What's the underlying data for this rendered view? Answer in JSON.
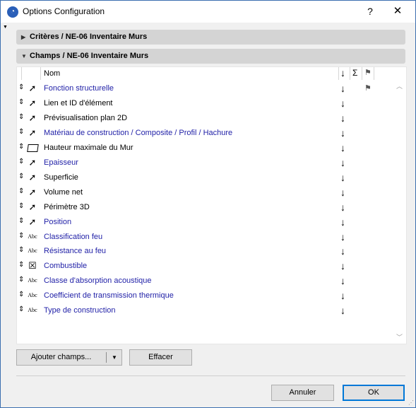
{
  "window": {
    "title": "Options Configuration",
    "help_label": "?",
    "close_label": "✕",
    "app_icon": "archicad-icon"
  },
  "sections": [
    {
      "label": "Critères / NE-06 Inventaire Murs",
      "expanded": false
    },
    {
      "label": "Champs / NE-06 Inventaire Murs",
      "expanded": true
    }
  ],
  "table": {
    "header": {
      "name": "Nom",
      "sort_symbol": "↓",
      "sum_symbol": "Σ",
      "flag_symbol": "⚑"
    },
    "rows": [
      {
        "type": "pointer",
        "name": "Fonction structurelle",
        "blue": true,
        "flag": "⚑"
      },
      {
        "type": "pointer",
        "name": "Lien et ID d'élément",
        "blue": false,
        "flag": ""
      },
      {
        "type": "pointer",
        "name": "Prévisualisation plan 2D",
        "blue": false,
        "flag": ""
      },
      {
        "type": "pointer",
        "name": "Matériau de construction / Composite / Profil / Hachure",
        "blue": true,
        "flag": ""
      },
      {
        "type": "polygon",
        "name": "Hauteur maximale du Mur",
        "blue": false,
        "flag": ""
      },
      {
        "type": "pointer",
        "name": "Epaisseur",
        "blue": true,
        "flag": ""
      },
      {
        "type": "pointer",
        "name": "Superficie",
        "blue": false,
        "flag": ""
      },
      {
        "type": "pointer",
        "name": "Volume net",
        "blue": false,
        "flag": ""
      },
      {
        "type": "pointer",
        "name": "Périmètre 3D",
        "blue": false,
        "flag": ""
      },
      {
        "type": "pointer",
        "name": "Position",
        "blue": true,
        "flag": ""
      },
      {
        "type": "abc",
        "name": "Classification feu",
        "blue": true,
        "flag": ""
      },
      {
        "type": "abc",
        "name": "Résistance au feu",
        "blue": true,
        "flag": ""
      },
      {
        "type": "checkbox",
        "name": "Combustible",
        "blue": true,
        "flag": ""
      },
      {
        "type": "abc",
        "name": "Classe d'absorption acoustique",
        "blue": true,
        "flag": ""
      },
      {
        "type": "abc",
        "name": "Coefficient de transmission thermique",
        "blue": true,
        "flag": ""
      },
      {
        "type": "abc",
        "name": "Type de construction",
        "blue": true,
        "flag": ""
      }
    ]
  },
  "buttons": {
    "add_fields": "Ajouter champs...",
    "clear": "Effacer",
    "cancel": "Annuler",
    "ok": "OK"
  },
  "icons": {
    "pointer": "➚",
    "abc": "Abc",
    "checkbox": "☒",
    "handle": "⇕",
    "sort": "↓"
  },
  "colors": {
    "link_blue": "#2222a8",
    "section_bg": "#d4d4d4",
    "ok_border": "#0078d7"
  }
}
